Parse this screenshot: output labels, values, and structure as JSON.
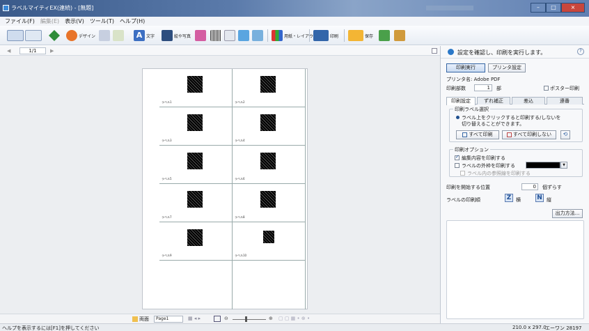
{
  "window": {
    "title": "ラベルマイティEX(連続) - [無題]",
    "controls": [
      "–",
      "□",
      "×"
    ]
  },
  "menu": {
    "items": [
      "ファイル(F)",
      "編集(E)",
      "表示(V)",
      "ツール(T)",
      "ヘルプ(H)"
    ]
  },
  "toolbar": {
    "design_label": "デザイン",
    "text_label": "文字",
    "photo_label": "絵や写真",
    "layout_label": "用紙・レイアウト",
    "print_label": "印刷",
    "save_label": "保存"
  },
  "nav": {
    "page_indicator": "1/1"
  },
  "sheet": {
    "labels": [
      "ラベル1",
      "ラベル2",
      "ラベル3",
      "ラベル4",
      "ラベル5",
      "ラベル6",
      "ラベル7",
      "ラベル8",
      "ラベル9",
      "ラベル10"
    ]
  },
  "zoombar": {
    "sheet_label": "両面",
    "page_name": "Page1"
  },
  "panel": {
    "header_msg": "設定を確認し、印刷を実行します。",
    "help": "?",
    "print_exec": "印刷実行",
    "printer_settings": "プリンタ設定",
    "printer_name": "プリンタ名: Adobe PDF",
    "copies_label": "印刷部数",
    "copies_value": "1",
    "copies_unit": "部",
    "poster_print": "ポスター印刷",
    "tabs": [
      "印刷設定",
      "ずれ補正",
      "差込",
      "連番"
    ],
    "label_select_title": "印刷ラベル選択",
    "label_select_desc_1": "ラベル上をクリックすると印刷する/しないを",
    "label_select_desc_2": "切り替えることができます。",
    "print_all": "すべて印刷",
    "print_none": "すべて印刷しない",
    "options_title": "印刷オプション",
    "opt_print_edit": "編集内容を印刷する",
    "opt_print_outline": "ラベルの外枠を印刷する",
    "opt_print_guides": "ラベル内の参照線を印刷する",
    "start_pos_label": "印刷を開始する位置",
    "start_pos_value": "0",
    "start_pos_unit": "個ずらす",
    "order_label": "ラベルの印刷順",
    "order_horizontal": "横",
    "order_vertical": "縦",
    "output_method": "出力方法..."
  },
  "status": {
    "help_text": "ヘルプを表示するには[F1]を押してください",
    "paper_size": "210.0 x 297.0",
    "paper_name": "エーワン 28197"
  },
  "colors": {
    "title_bar": "#3a5a8a",
    "accent": "#2b78c8",
    "close_button": "#c8463c"
  }
}
